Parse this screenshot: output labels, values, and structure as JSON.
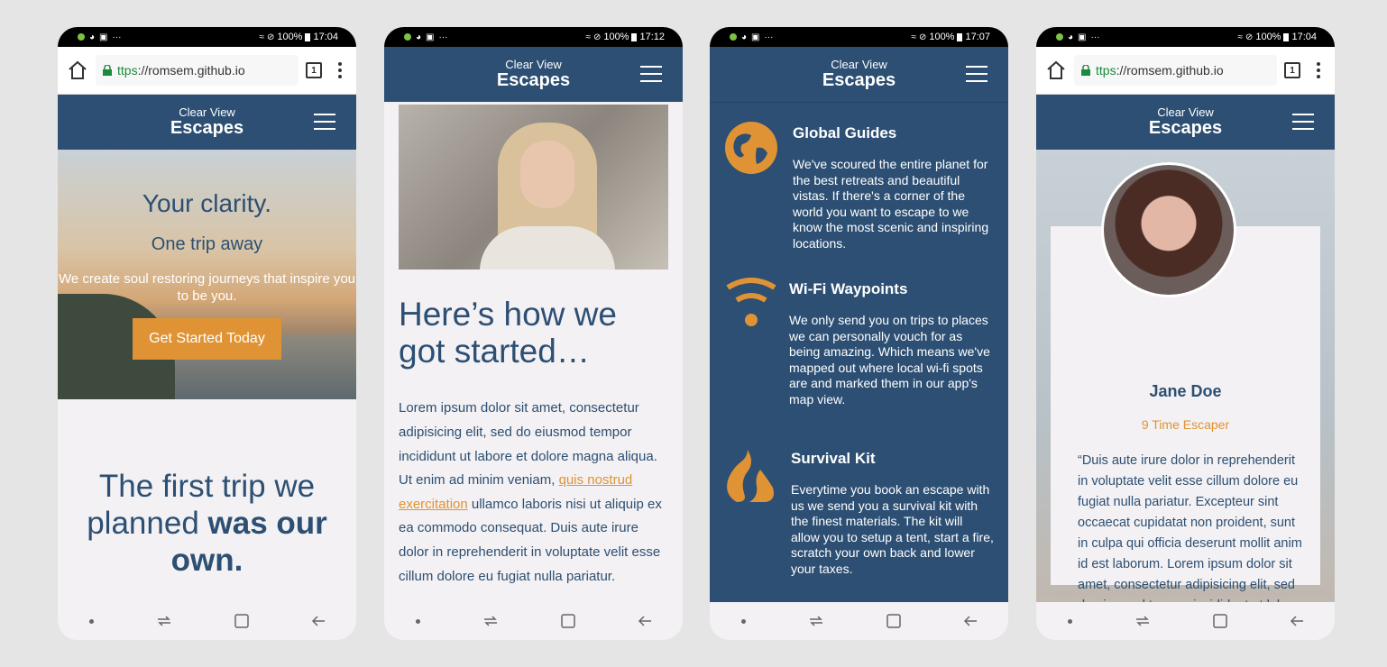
{
  "status_bars": [
    {
      "battery": "100%",
      "time": "17:04",
      "dots": "···"
    },
    {
      "battery": "100%",
      "time": "17:12",
      "dots": "···"
    },
    {
      "battery": "100%",
      "time": "17:07",
      "dots": "···"
    },
    {
      "battery": "100%",
      "time": "17:04",
      "dots": "···"
    }
  ],
  "browser": {
    "url_scheme": "ttps",
    "url_rest": "://romsem.github.io",
    "tab_count": "1"
  },
  "site": {
    "brand_small": "Clear View",
    "brand_big": "Escapes"
  },
  "phone1": {
    "hero_title": "Your clarity.",
    "hero_subtitle": "One trip away",
    "hero_desc": "We create soul restoring journeys that inspire you to be you.",
    "cta_label": "Get Started Today",
    "first_trip_a": "The first trip we planned ",
    "first_trip_b": "was our own."
  },
  "phone2": {
    "heading": "Here’s how we got started…",
    "para_a": "Lorem ipsum dolor sit amet, consectetur adipisicing elit, sed do eiusmod tempor incididunt ut labore et dolore magna aliqua. Ut enim ad minim veniam, ",
    "para_link": "quis nostrud exercitation",
    "para_b": " ullamco laboris nisi ut aliquip ex ea commodo consequat. Duis aute irure dolor in reprehenderit in voluptate velit esse cillum dolore eu fugiat nulla pariatur. Excepteur sint occaecat"
  },
  "phone3": {
    "features": [
      {
        "icon": "globe-icon",
        "title": "Global Guides",
        "text": "We've scoured the entire planet for the best retreats and beautiful vistas. If there's a corner of the world you want to escape to we know the most scenic and inspiring locations."
      },
      {
        "icon": "wifi-icon",
        "title": "Wi-Fi Waypoints",
        "text": "We only send you on trips to places we can personally vouch for as being amazing. Which means we've mapped out where local wi-fi spots are and marked them in our app's map view."
      },
      {
        "icon": "fire-icon",
        "title": "Survival Kit",
        "text": "Everytime you book an escape with us we send you a survival kit with the finest materials. The kit will allow you to setup a tent, start a fire, scratch your own back and lower your taxes."
      }
    ]
  },
  "phone4": {
    "name": "Jane Doe",
    "role": "9 Time Escaper",
    "quote": "“Duis aute irure dolor in reprehenderit in voluptate velit esse cillum dolore eu fugiat nulla pariatur. Excepteur sint occaecat cupidatat non proident, sunt in culpa qui officia deserunt mollit anim id est laborum. Lorem ipsum dolor sit amet, consectetur adipisicing elit, sed do eiusmod tempor incididunt ut labore et dolore magna aliqua.”"
  },
  "colors": {
    "brand_blue": "#2c4f73",
    "accent_orange": "#e09334"
  }
}
